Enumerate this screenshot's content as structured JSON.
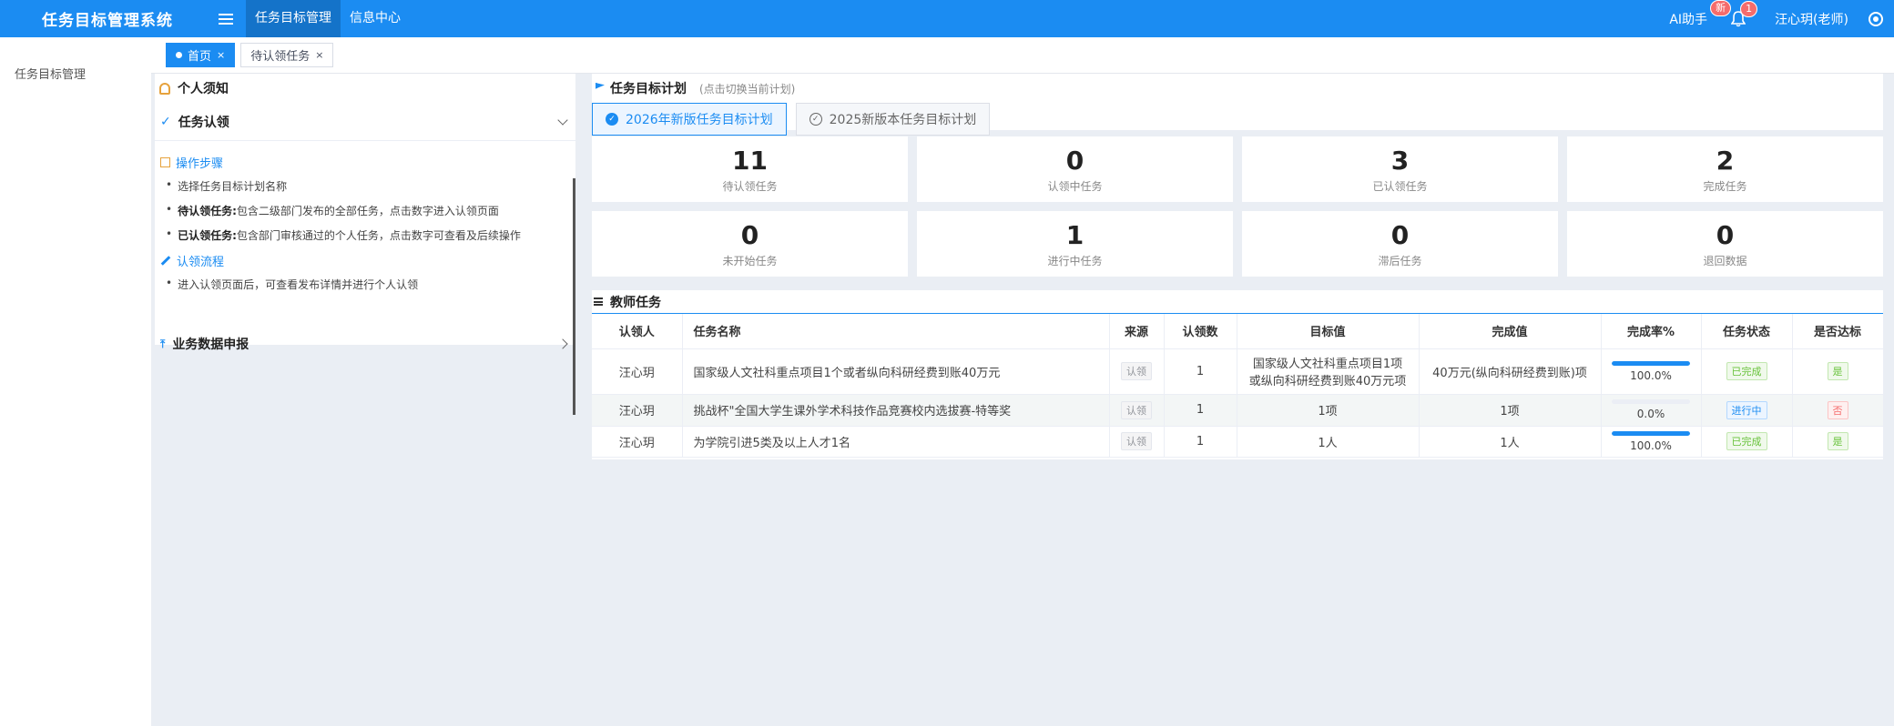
{
  "app": {
    "title": "任务目标管理系统",
    "nav": [
      "任务目标管理",
      "信息中心"
    ],
    "ai_helper": "AI助手",
    "ai_badge": "新",
    "bell_badge": "1",
    "user": "汪心玥(老师)"
  },
  "sidebar": {
    "items": [
      "任务目标管理"
    ]
  },
  "tabs": [
    {
      "label": "首页",
      "close": "×"
    },
    {
      "label": "待认领任务",
      "close": "×"
    }
  ],
  "notice": {
    "title": "个人须知",
    "section_claim": "任务认领",
    "steps_title": "操作步骤",
    "steps": [
      {
        "strong": "",
        "text": "选择任务目标计划名称"
      },
      {
        "strong": "待认领任务:",
        "text": "包含二级部门发布的全部任务，点击数字进入认领页面"
      },
      {
        "strong": "已认领任务:",
        "text": "包含部门审核通过的个人任务，点击数字可查看及后续操作"
      }
    ],
    "flow_title": "认领流程",
    "flow": [
      "进入认领页面后，可查看发布详情并进行个人认领"
    ],
    "section_report": "业务数据申报"
  },
  "plan": {
    "title": "任务目标计划",
    "hint": "(点击切换当前计划)",
    "tabs": [
      "2026年新版任务目标计划",
      "2025新版本任务目标计划"
    ]
  },
  "stats": [
    {
      "value": "11",
      "label": "待认领任务"
    },
    {
      "value": "0",
      "label": "认领中任务"
    },
    {
      "value": "3",
      "label": "已认领任务"
    },
    {
      "value": "2",
      "label": "完成任务"
    },
    {
      "value": "0",
      "label": "未开始任务"
    },
    {
      "value": "1",
      "label": "进行中任务"
    },
    {
      "value": "0",
      "label": "滞后任务"
    },
    {
      "value": "0",
      "label": "退回数据"
    }
  ],
  "tasks": {
    "title": "教师任务",
    "columns": [
      "认领人",
      "任务名称",
      "来源",
      "认领数",
      "目标值",
      "完成值",
      "完成率%",
      "任务状态",
      "是否达标"
    ],
    "rows": [
      {
        "claimer": "汪心玥",
        "name": "国家级人文社科重点项目1个或者纵向科研经费到账40万元",
        "source": "认领",
        "count": "1",
        "target_line1": "国家级人文社科重点项目1项",
        "target_line2": "或纵向科研经费到账40万元项",
        "done": "40万元(纵向科研经费到账)项",
        "rate": 100.0,
        "rate_text": "100.0%",
        "status": "已完成",
        "ok": "是"
      },
      {
        "claimer": "汪心玥",
        "name": "挑战杯\"全国大学生课外学术科技作品竞赛校内选拔赛-特等奖",
        "source": "认领",
        "count": "1",
        "target_line1": "1项",
        "target_line2": "",
        "done": "1项",
        "rate": 0.0,
        "rate_text": "0.0%",
        "status": "进行中",
        "ok": "否"
      },
      {
        "claimer": "汪心玥",
        "name": "为学院引进5类及以上人才1名",
        "source": "认领",
        "count": "1",
        "target_line1": "1人",
        "target_line2": "",
        "done": "1人",
        "rate": 100.0,
        "rate_text": "100.0%",
        "status": "已完成",
        "ok": "是"
      }
    ]
  }
}
